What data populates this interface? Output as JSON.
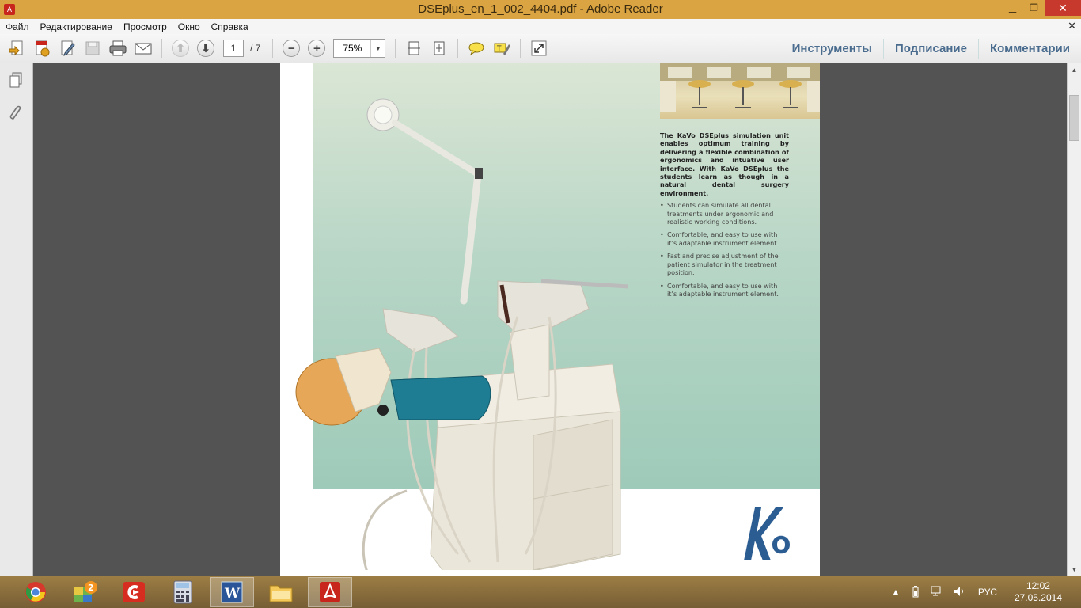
{
  "window": {
    "title": "DSEplus_en_1_002_4404.pdf - Adobe Reader",
    "minimize": "▁",
    "restore": "❐",
    "close": "✕"
  },
  "menu": {
    "items": [
      "Файл",
      "Редактирование",
      "Просмотр",
      "Окно",
      "Справка"
    ],
    "close": "✕"
  },
  "toolbar": {
    "page_current": "1",
    "page_total": "/ 7",
    "zoom": "75%",
    "right_tabs": [
      "Инструменты",
      "Подписание",
      "Комментарии"
    ]
  },
  "document": {
    "intro": "The KaVo DSEplus simulation unit ena­bles optimum training by delivering a flexible combination of ergonomics and intuative user interface. With KaVo DSEplus the students learn as though in a natural dental surgery environment.",
    "bullets": [
      "Students can simulate all dental treatments under ergonomic and realistic working conditions.",
      "Comfortable, and easy to use with it’s adaptable instrument element.",
      "Fast and precise adjustment of the patient simulator in the treatment position.",
      "Comfortable, and easy to use with it’s adaptable instrument element."
    ]
  },
  "taskbar": {
    "language": "РУС",
    "time": "12:02",
    "date": "27.05.2014",
    "badge": "2"
  },
  "colors": {
    "titlebar": "#d9a441",
    "accent_tabs": "#4a6c8e",
    "doc_bg": "#535353"
  }
}
